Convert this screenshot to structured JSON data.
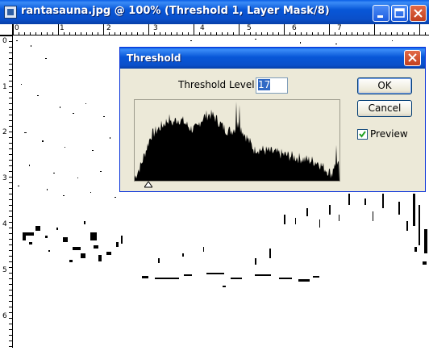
{
  "window": {
    "title": "rantasauna.jpg @ 100% (Threshold 1, Layer Mask/8)",
    "buttons": {
      "minimize": "minimize-icon",
      "maximize": "maximize-icon",
      "close": "close-icon"
    }
  },
  "rulers": {
    "top_labels": [
      "0",
      "1",
      "2",
      "3",
      "4",
      "5",
      "6",
      "7"
    ],
    "left_labels": [
      "0",
      "1",
      "2",
      "3",
      "4",
      "5",
      "6"
    ]
  },
  "dialog": {
    "title": "Threshold",
    "level_label": "Threshold Level:",
    "level_value": "17",
    "ok_label": "OK",
    "cancel_label": "Cancel",
    "preview_label": "Preview",
    "preview_checked": true
  },
  "colors": {
    "titlebar": "#0a5ee6",
    "dialog_bg": "#ece9d8",
    "close_red": "#c2401e"
  }
}
